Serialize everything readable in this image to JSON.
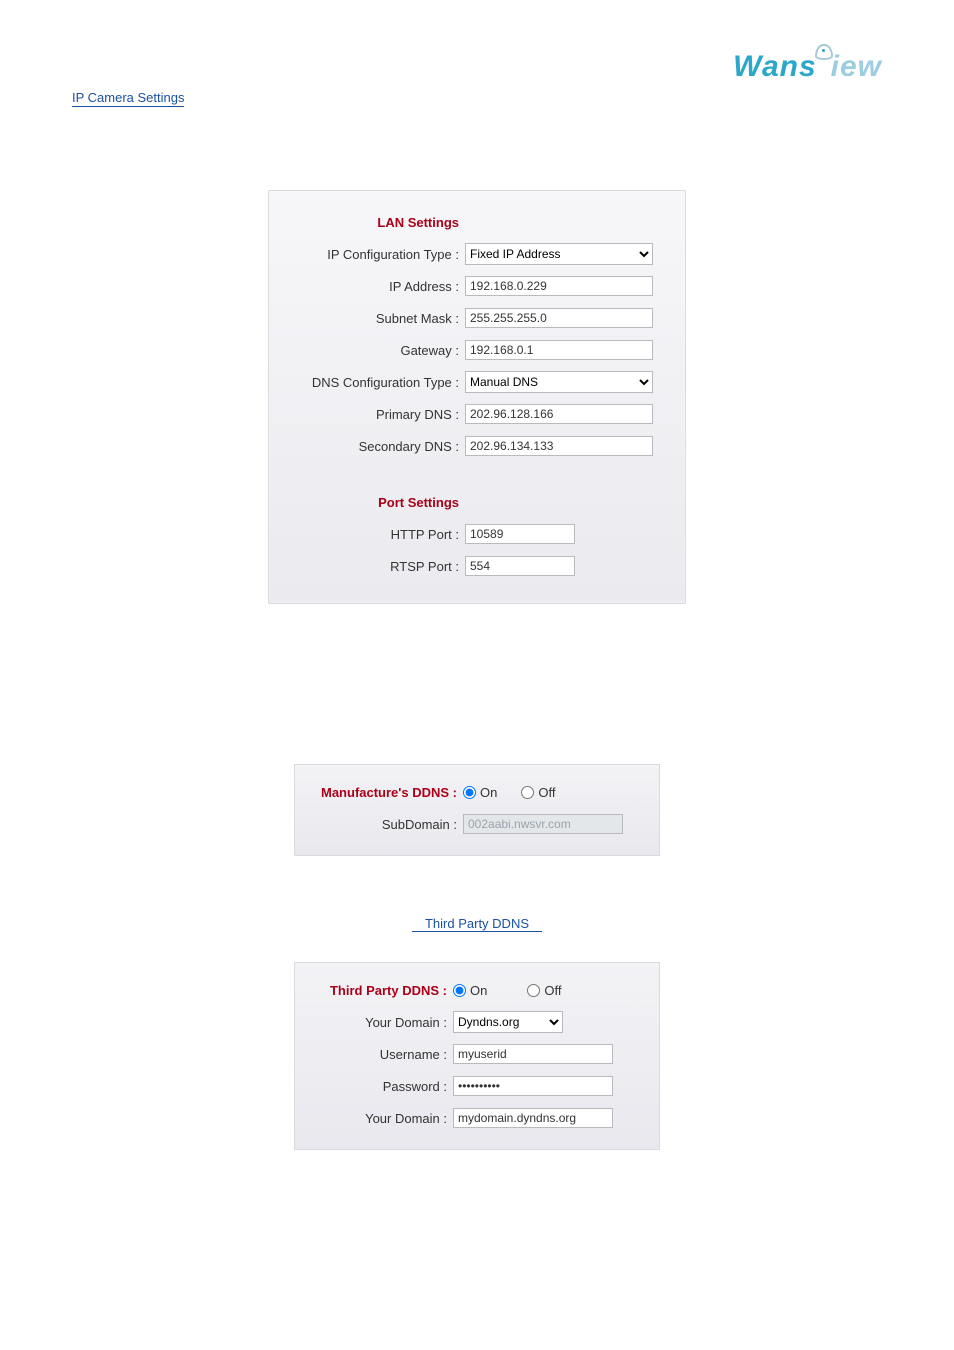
{
  "brand": {
    "prefix": "Wans",
    "suffix": "iew"
  },
  "top_link": "IP Camera Settings",
  "lan": {
    "section_title": "LAN Settings",
    "ip_configuration_label": "IP Configuration Type :",
    "ip_configuration_value": "Fixed IP Address",
    "ip_address_label": "IP Address :",
    "ip_address_value": "192.168.0.229",
    "subnet_mask_label": "Subnet Mask :",
    "subnet_mask_value": "255.255.255.0",
    "gateway_label": "Gateway :",
    "gateway_value": "192.168.0.1",
    "dns_configuration_label": "DNS Configuration Type :",
    "dns_configuration_value": "Manual DNS",
    "primary_dns_label": "Primary DNS :",
    "primary_dns_value": "202.96.128.166",
    "secondary_dns_label": "Secondary DNS :",
    "secondary_dns_value": "202.96.134.133"
  },
  "port": {
    "section_title": "Port Settings",
    "http_port_label": "HTTP Port :",
    "http_port_value": "10589",
    "rtsp_port_label": "RTSP Port :",
    "rtsp_port_value": "554"
  },
  "mddns": {
    "title": "Manufacture's DDNS :",
    "on_label": "On",
    "off_label": "Off",
    "on_selected": true,
    "subdomain_label": "SubDomain :",
    "subdomain_value": "002aabi.nwsvr.com"
  },
  "mid_link": "Third Party DDNS",
  "tddns": {
    "title": "Third Party DDNS :",
    "on_label": "On",
    "off_label": "Off",
    "on_selected": true,
    "your_domain_provider_label": "Your Domain :",
    "your_domain_provider_value": "Dyndns.org",
    "username_label": "Username :",
    "username_value": "myuserid",
    "password_label": "Password :",
    "password_value": "••••••••••",
    "your_domain_label": "Your Domain :",
    "your_domain_value": "mydomain.dyndns.org"
  }
}
